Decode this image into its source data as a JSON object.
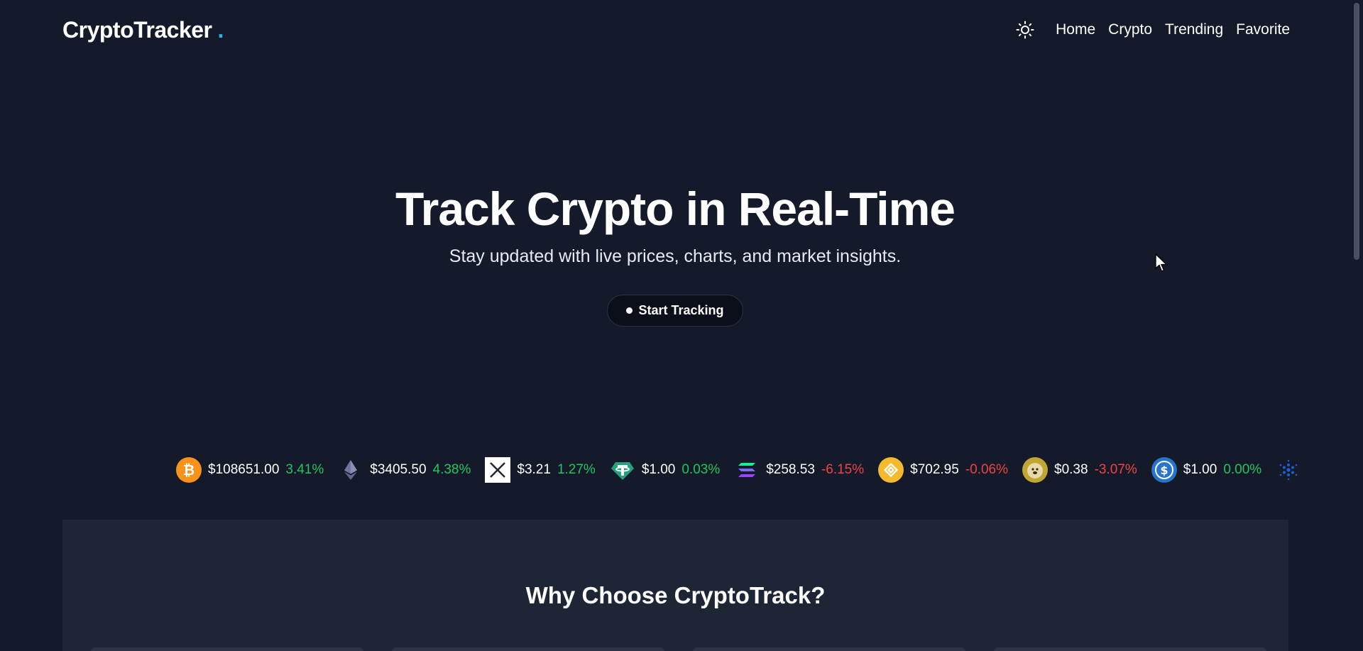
{
  "header": {
    "logo": "CryptoTracker",
    "logo_dot": ".",
    "theme_icon": "sun-icon",
    "nav": [
      "Home",
      "Crypto",
      "Trending",
      "Favorite"
    ]
  },
  "hero": {
    "title": "Track Crypto in Real-Time",
    "subtitle": "Stay updated with live prices, charts, and market insights.",
    "cta_label": "Start Tracking"
  },
  "ticker": [
    {
      "icon": "bitcoin-icon",
      "price": "$108651.00",
      "change": "3.41%",
      "direction": "up",
      "color": "#f7931a"
    },
    {
      "icon": "ethereum-icon",
      "price": "$3405.50",
      "change": "4.38%",
      "direction": "up",
      "color": "#8c8fb8"
    },
    {
      "icon": "xrp-icon",
      "price": "$3.21",
      "change": "1.27%",
      "direction": "up",
      "color": "#ffffff"
    },
    {
      "icon": "tether-icon",
      "price": "$1.00",
      "change": "0.03%",
      "direction": "up",
      "color": "#26a17b"
    },
    {
      "icon": "solana-icon",
      "price": "$258.53",
      "change": "-6.15%",
      "direction": "down",
      "color": "#9945ff"
    },
    {
      "icon": "bnb-icon",
      "price": "$702.95",
      "change": "-0.06%",
      "direction": "down",
      "color": "#f3ba2f"
    },
    {
      "icon": "dogecoin-icon",
      "price": "$0.38",
      "change": "-3.07%",
      "direction": "down",
      "color": "#c2a633"
    },
    {
      "icon": "usdc-icon",
      "price": "$1.00",
      "change": "0.00%",
      "direction": "up",
      "color": "#2775ca"
    },
    {
      "icon": "cardano-icon",
      "price": "",
      "change": "",
      "direction": "up",
      "color": "#0033ad"
    }
  ],
  "features": {
    "title": "Why Choose CryptoTrack?"
  },
  "colors": {
    "background": "#141a2a",
    "section": "#1e2636",
    "accent": "#22b5e6",
    "up": "#22c55e",
    "down": "#ef4444"
  }
}
